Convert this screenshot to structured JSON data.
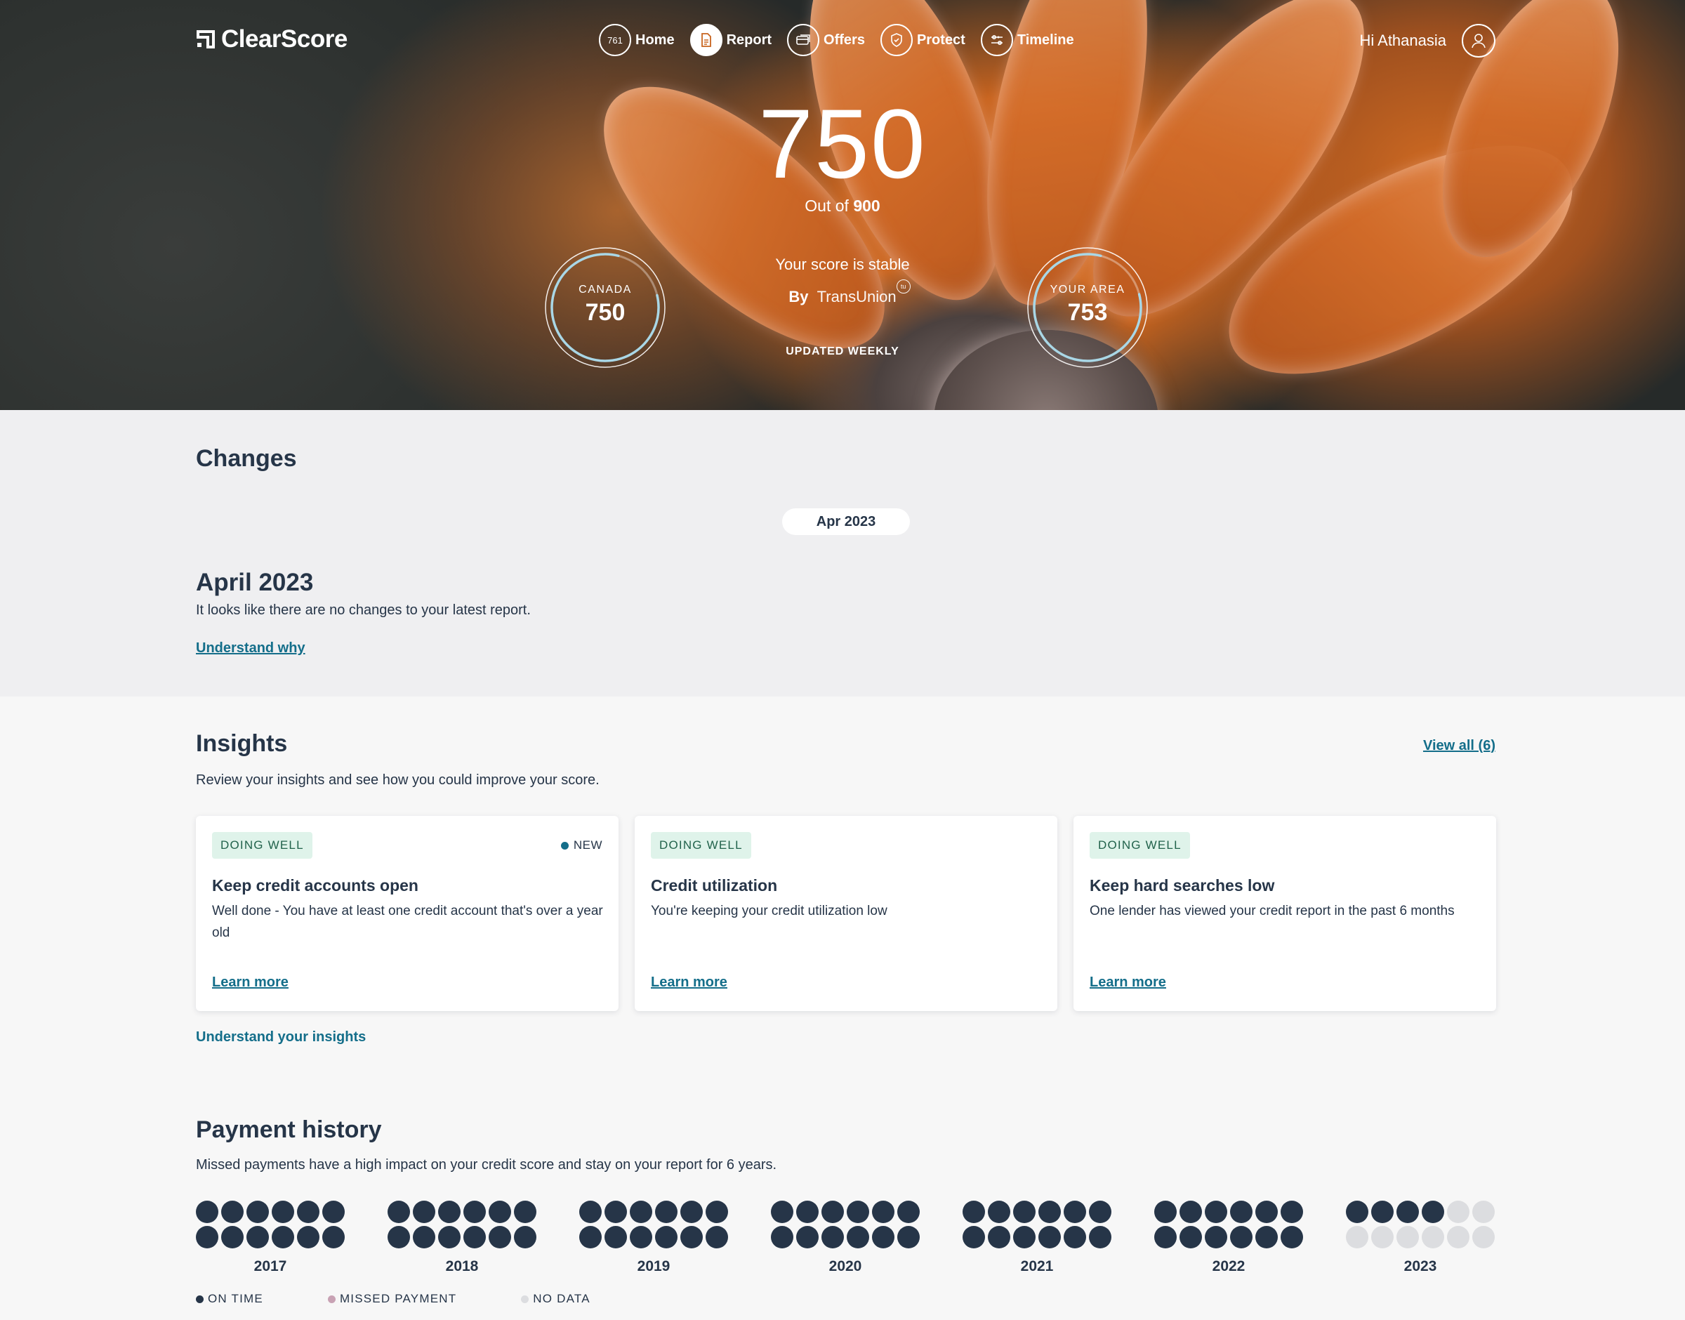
{
  "brand": {
    "name": "ClearScore"
  },
  "nav": {
    "home_badge": "761",
    "items": [
      {
        "label": "Home"
      },
      {
        "label": "Report"
      },
      {
        "label": "Offers"
      },
      {
        "label": "Protect"
      },
      {
        "label": "Timeline"
      }
    ],
    "greeting": "Hi Athanasia"
  },
  "score": {
    "value": "750",
    "out_of_prefix": "Out of",
    "out_of_value": "900",
    "status": "Your score is stable",
    "by_prefix": "By",
    "bureau": "TransUnion",
    "bureau_mark": "tu",
    "updated": "UPDATED WEEKLY",
    "max": 900,
    "canada": {
      "label": "CANADA",
      "value": "750",
      "score": 750
    },
    "area": {
      "label": "YOUR AREA",
      "value": "753",
      "score": 753
    }
  },
  "changes": {
    "title": "Changes",
    "month_pill": "Apr 2023",
    "month_title": "April 2023",
    "description": "It looks like there are no changes to your latest report.",
    "link": "Understand why"
  },
  "insights": {
    "title": "Insights",
    "view_all": "View all (6)",
    "description": "Review your insights and see how you could improve your score.",
    "cards": [
      {
        "badge": "DOING WELL",
        "new": "NEW",
        "title": "Keep credit accounts open",
        "desc": "Well done - You have at least one credit account that's over a year old",
        "link": "Learn more"
      },
      {
        "badge": "DOING WELL",
        "title": "Credit utilization",
        "desc": "You're keeping your credit utilization low",
        "link": "Learn more"
      },
      {
        "badge": "DOING WELL",
        "title": "Keep hard searches low",
        "desc": "One lender has viewed your credit report in the past 6 months",
        "link": "Learn more"
      }
    ],
    "understand_link": "Understand your insights"
  },
  "payment_history": {
    "title": "Payment history",
    "description": "Missed payments have a high impact on your credit score and stay on your report for 6 years.",
    "years": [
      {
        "year": "2017",
        "on_time": 12,
        "no_data": 0
      },
      {
        "year": "2018",
        "on_time": 12,
        "no_data": 0
      },
      {
        "year": "2019",
        "on_time": 12,
        "no_data": 0
      },
      {
        "year": "2020",
        "on_time": 12,
        "no_data": 0
      },
      {
        "year": "2021",
        "on_time": 12,
        "no_data": 0
      },
      {
        "year": "2022",
        "on_time": 12,
        "no_data": 0
      },
      {
        "year": "2023",
        "on_time": 4,
        "no_data": 8
      }
    ],
    "legend": [
      {
        "label": "ON TIME",
        "color": "#263548"
      },
      {
        "label": "MISSED PAYMENT",
        "color": "#c8a2b4"
      },
      {
        "label": "NO DATA",
        "color": "#dcdde0"
      }
    ]
  },
  "colors": {
    "accent": "#146e8a",
    "navy": "#263548",
    "badge_bg": "#dff3ea"
  }
}
